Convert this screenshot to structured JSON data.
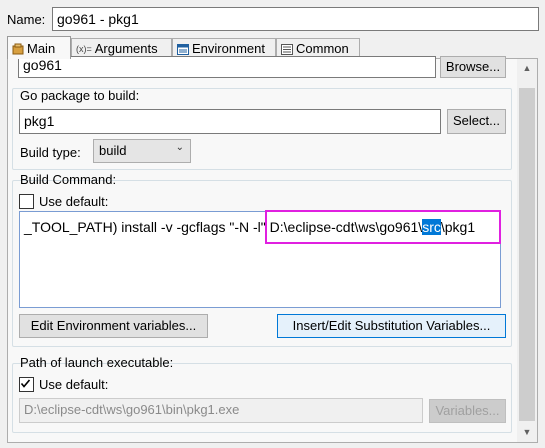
{
  "name": {
    "label": "Name:",
    "value": "go961 - pkg1"
  },
  "tabs": [
    {
      "label": "Main",
      "icon": "main-tab-icon"
    },
    {
      "label": "Arguments",
      "icon": "arguments-icon"
    },
    {
      "label": "Environment",
      "icon": "environment-icon"
    },
    {
      "label": "Common",
      "icon": "common-icon"
    }
  ],
  "project": {
    "value": "go961",
    "browse_label": "Browse..."
  },
  "package": {
    "group_label": "Go package to build:",
    "value": "pkg1",
    "select_label": "Select..."
  },
  "build_type": {
    "label": "Build type:",
    "value": "build"
  },
  "build_command": {
    "group_label": "Build Command:",
    "use_default_label": "Use default:",
    "use_default_checked": false,
    "text_prefix": "_TOOL_PATH) install -v -gcflags \"-N -l\" ",
    "text_path": "D:\\eclipse-cdt\\ws\\go961\\",
    "text_selected": "src",
    "text_suffix": "\\pkg1",
    "edit_env_label": "Edit Environment variables...",
    "subst_label": "Insert/Edit Substitution Variables..."
  },
  "launch": {
    "group_label": "Path of launch executable:",
    "use_default_label": "Use default:",
    "use_default_checked": true,
    "value": "D:\\eclipse-cdt\\ws\\go961\\bin\\pkg1.exe",
    "variables_label": "Variables..."
  },
  "colors": {
    "highlight": "#e020e0",
    "selection": "#0078d7"
  }
}
